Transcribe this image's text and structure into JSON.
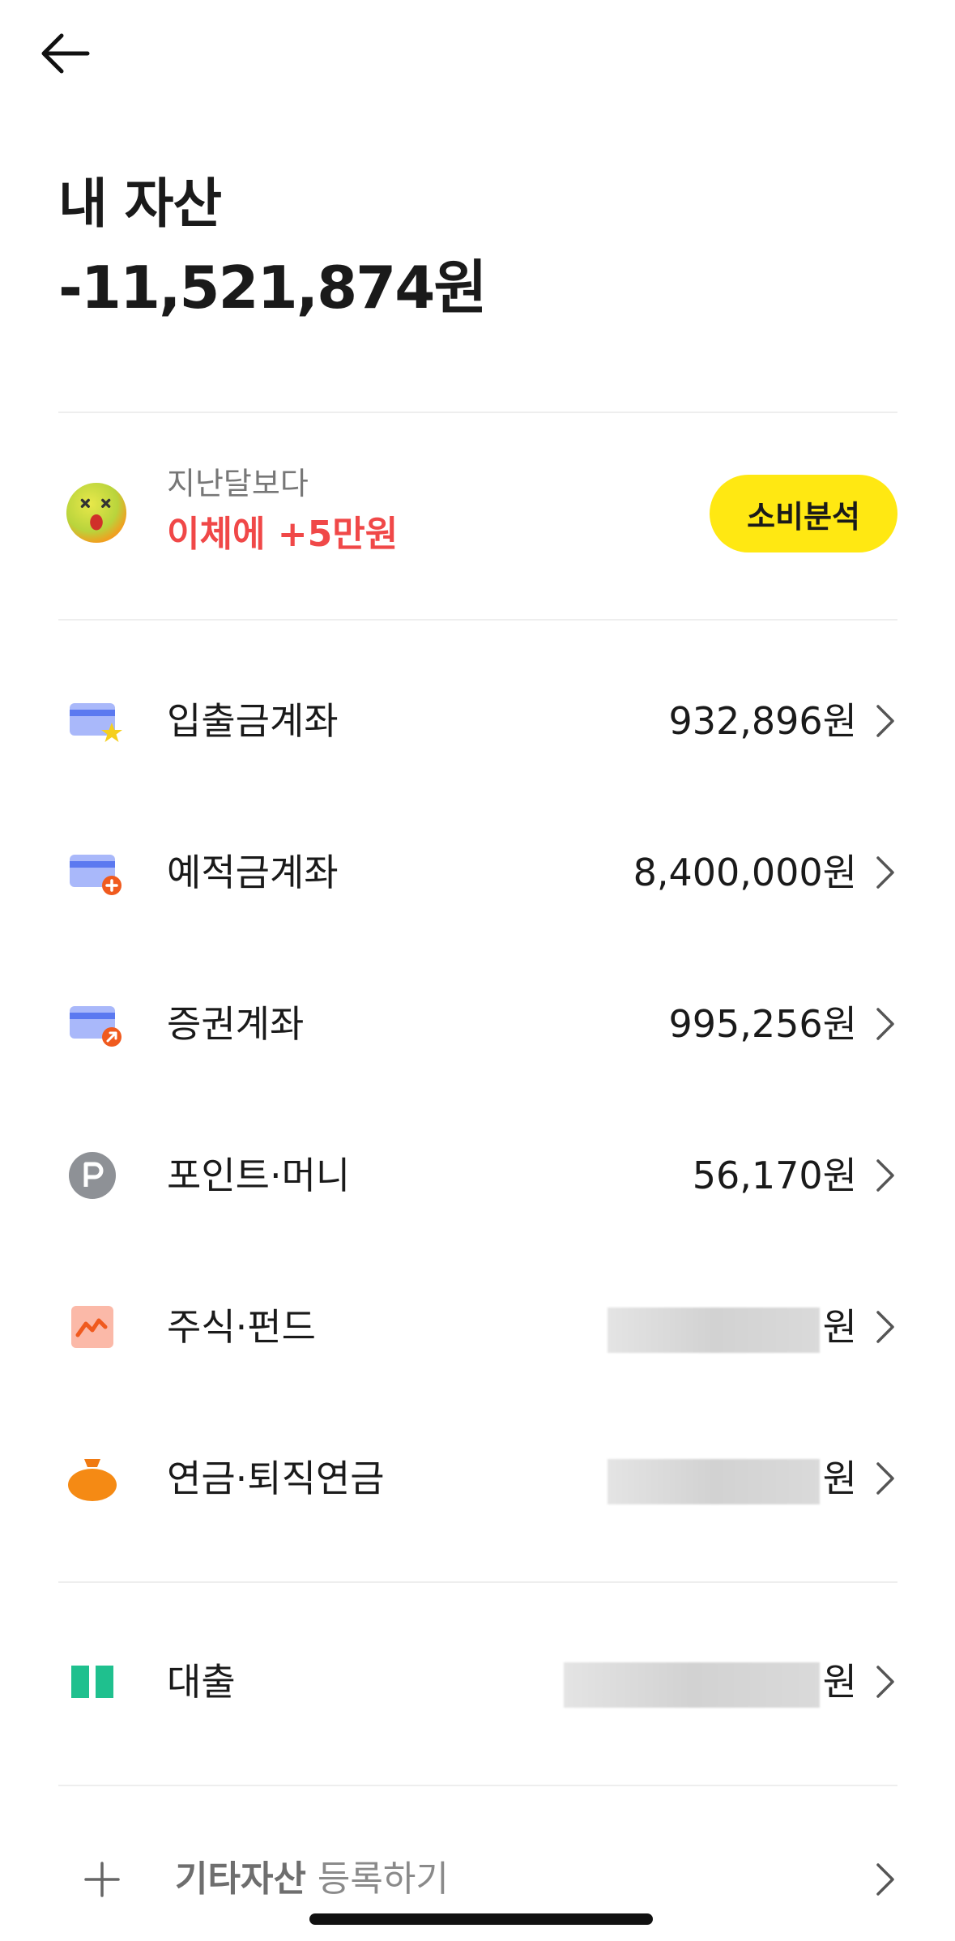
{
  "header": {
    "back_icon": "arrow-left-icon",
    "title": "내 자산",
    "total": "-11,521,874원"
  },
  "compare": {
    "icon": "dizzy-face-icon",
    "subtitle": "지난달보다",
    "highlight": "이체에 +5만원",
    "highlight_color": "#f04848",
    "button_label": "소비분석",
    "button_color": "#ffe812"
  },
  "assets": [
    {
      "label": "입출금계좌",
      "value": "932,896원",
      "icon": "card-star-icon"
    },
    {
      "label": "예적금계좌",
      "value": "8,400,000원",
      "icon": "card-plus-icon"
    },
    {
      "label": "증권계좌",
      "value": "995,256원",
      "icon": "card-arrow-icon"
    },
    {
      "label": "포인트·머니",
      "value": "56,170원",
      "icon": "point-p-icon"
    },
    {
      "label": "주식·펀드",
      "value": "원",
      "icon": "stock-chart-icon"
    },
    {
      "label": "연금·퇴직연금",
      "value": "원",
      "icon": "money-pouch-icon"
    }
  ],
  "loan": {
    "label": "대출",
    "value": "원",
    "icon": "loan-bars-icon"
  },
  "add_other": {
    "strong_label": "기타자산",
    "label": " 등록하기",
    "icon": "plus-icon"
  }
}
